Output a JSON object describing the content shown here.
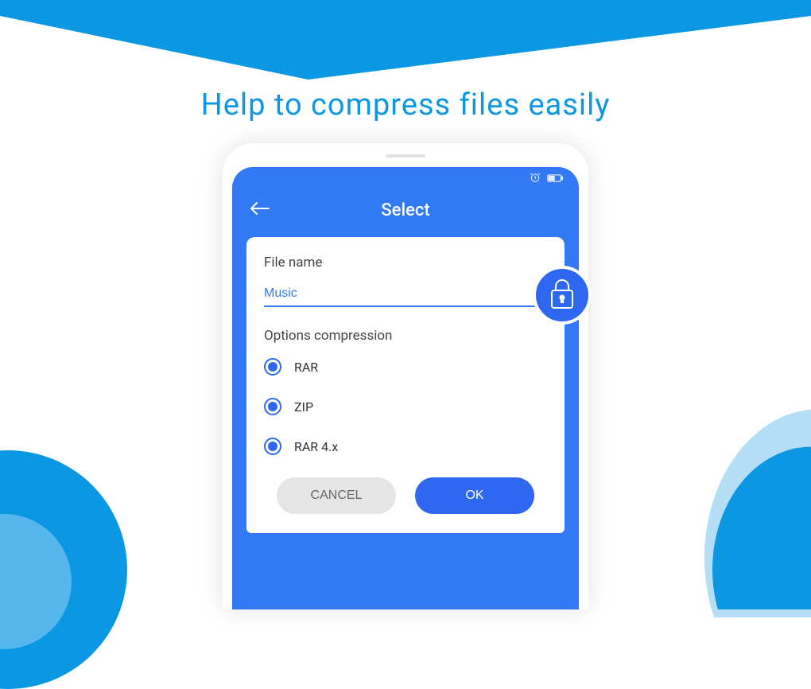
{
  "heading": "Help to compress files easily",
  "app_bar": {
    "title": "Select"
  },
  "dialog": {
    "file_name_label": "File name",
    "file_name_value": "Music",
    "options_label": "Options compression",
    "options": [
      {
        "label": "RAR",
        "selected": true
      },
      {
        "label": "ZIP",
        "selected": true
      },
      {
        "label": "RAR 4.x",
        "selected": true
      }
    ],
    "cancel_label": "CANCEL",
    "ok_label": "OK"
  },
  "icons": {
    "back": "back-arrow-icon",
    "lock": "lock-icon",
    "alarm": "alarm-icon",
    "battery": "battery-icon"
  },
  "colors": {
    "accent": "#0c97e2",
    "primary": "#3279f6",
    "button_primary": "#2f68f0"
  }
}
